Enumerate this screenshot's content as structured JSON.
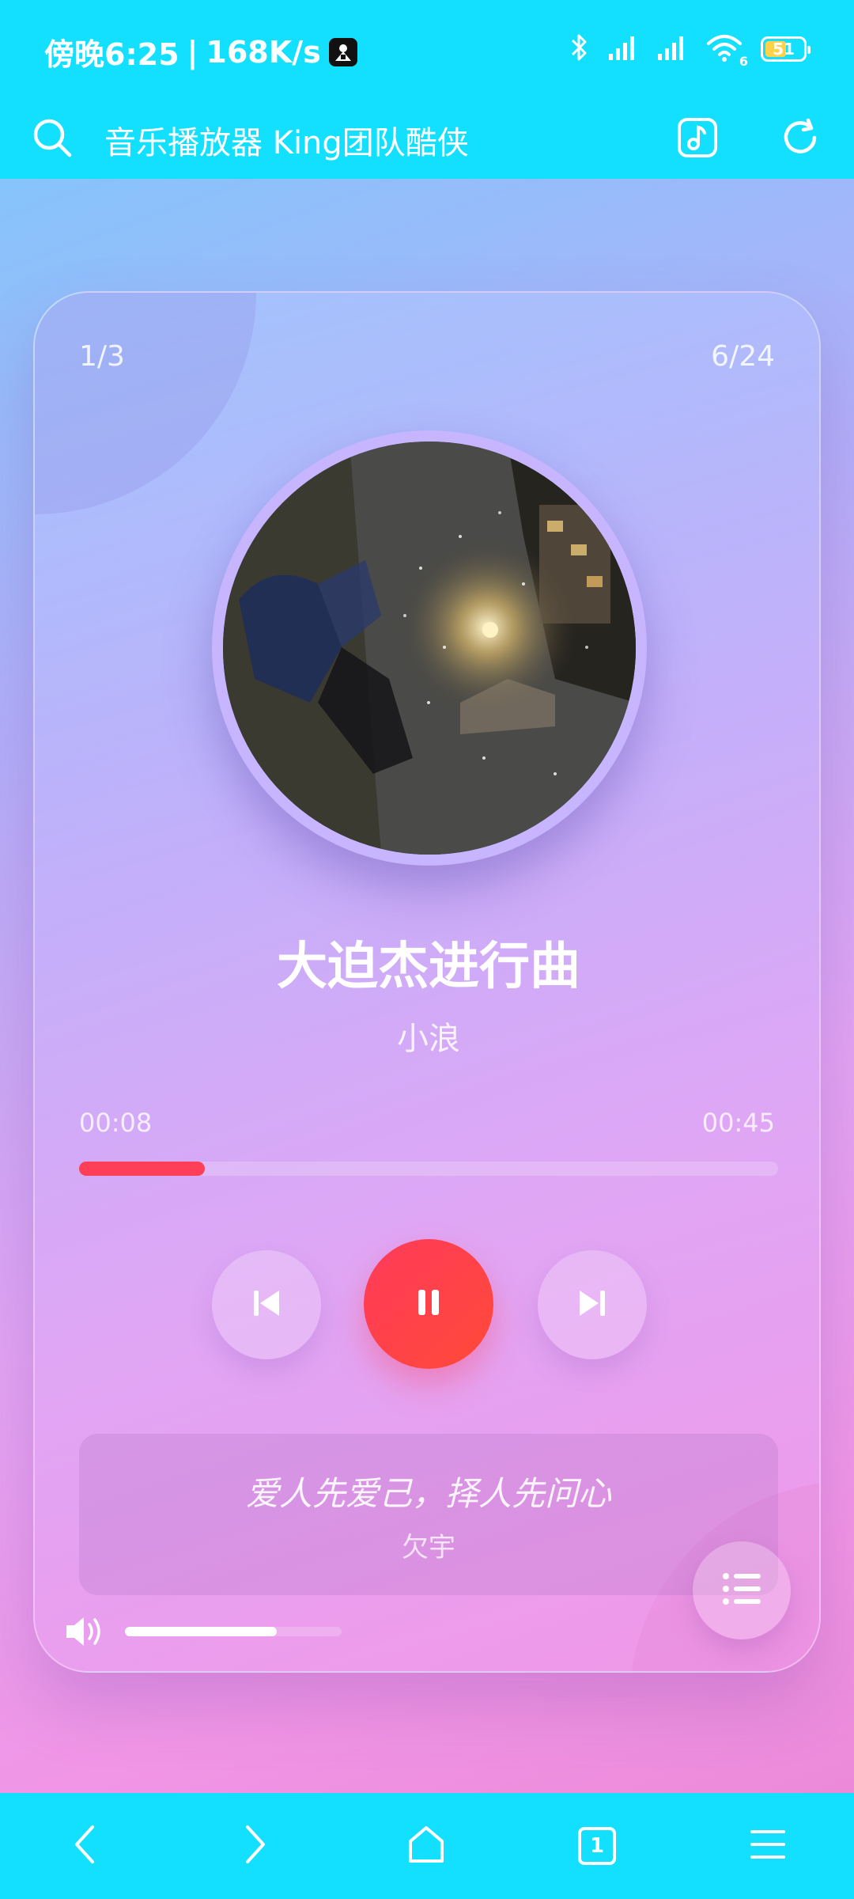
{
  "status_bar": {
    "time": "傍晚6:25",
    "separator": "|",
    "speed": "168K/s",
    "battery_level": "51",
    "wifi_badge": "6",
    "icons": [
      "bluetooth-icon",
      "signal-icon",
      "signal-icon",
      "wifi-icon",
      "battery-icon"
    ]
  },
  "app_bar": {
    "title": "音乐播放器 King团队酷侠",
    "icons": [
      "search-icon",
      "music-note-icon",
      "refresh-icon"
    ]
  },
  "player": {
    "page_counter": "1/3",
    "track_counter": "6/24",
    "song_title": "大迫杰进行曲",
    "artist": "小浪",
    "time_current": "00:08",
    "time_total": "00:45",
    "progress": 0.18,
    "volume": 0.7,
    "state": "playing"
  },
  "quote": {
    "text": "爱人先爱己，择人先问心",
    "author": "欠宇"
  },
  "colors": {
    "chrome": "#13e0ff",
    "accent_red": "#ff3e58",
    "disc_ring": "#c7b5ff"
  },
  "bottom_nav": {
    "tab_count": "1",
    "icons": [
      "back-icon",
      "forward-icon",
      "home-icon",
      "tabs-icon",
      "menu-icon"
    ]
  }
}
